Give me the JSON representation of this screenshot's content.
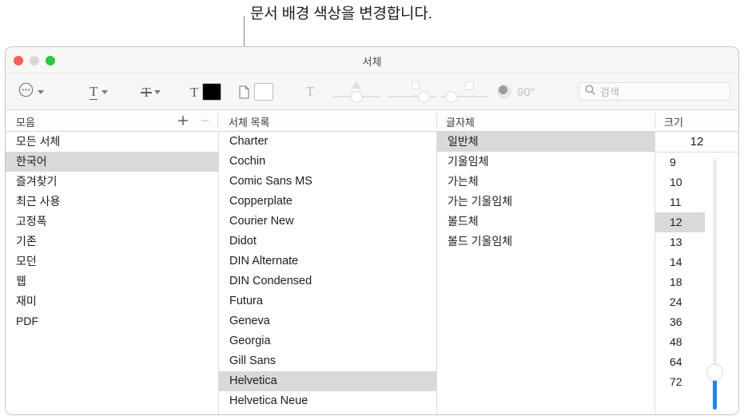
{
  "annotation": {
    "text": "문서 배경 색상을 변경합니다.",
    "line_color": "#8a8a8a"
  },
  "window": {
    "title": "서체",
    "traffic_lights": {
      "close": "#ff5f57",
      "minimize": "#d8d8d8",
      "zoom": "#28c840"
    }
  },
  "toolbar": {
    "action_menu": "action-menu",
    "underline_menu": "underline-menu",
    "strikethrough_menu": "strikethrough-menu",
    "text_color_label": "T",
    "text_color_value": "#000000",
    "document_color_value": "#ffffff",
    "shadow_toggle_label": "T",
    "shadow_opacity_slider": "shadow-opacity",
    "shadow_blur_slider": "shadow-blur",
    "shadow_offset_slider": "shadow-offset",
    "shadow_angle_value": "90°",
    "search": {
      "placeholder": "검색",
      "value": ""
    }
  },
  "columns": {
    "collection_header": "모음",
    "add_button": "+",
    "remove_button": "−",
    "family_header": "서체 목록",
    "typeface_header": "글자체",
    "size_header": "크기"
  },
  "collections": {
    "items": [
      {
        "label": "모든 서체",
        "selected": false
      },
      {
        "label": "한국어",
        "selected": true
      },
      {
        "label": "즐겨찾기",
        "selected": false
      },
      {
        "label": "최근 사용",
        "selected": false
      },
      {
        "label": "고정폭",
        "selected": false
      },
      {
        "label": "기존",
        "selected": false
      },
      {
        "label": "모던",
        "selected": false
      },
      {
        "label": "웹",
        "selected": false
      },
      {
        "label": "재미",
        "selected": false
      },
      {
        "label": "PDF",
        "selected": false
      }
    ]
  },
  "families": {
    "items": [
      {
        "label": "Charter",
        "selected": false
      },
      {
        "label": "Cochin",
        "selected": false
      },
      {
        "label": "Comic Sans MS",
        "selected": false
      },
      {
        "label": "Copperplate",
        "selected": false
      },
      {
        "label": "Courier New",
        "selected": false
      },
      {
        "label": "Didot",
        "selected": false
      },
      {
        "label": "DIN Alternate",
        "selected": false
      },
      {
        "label": "DIN Condensed",
        "selected": false
      },
      {
        "label": "Futura",
        "selected": false
      },
      {
        "label": "Geneva",
        "selected": false
      },
      {
        "label": "Georgia",
        "selected": false
      },
      {
        "label": "Gill Sans",
        "selected": false
      },
      {
        "label": "Helvetica",
        "selected": true
      },
      {
        "label": "Helvetica Neue",
        "selected": false
      }
    ]
  },
  "typefaces": {
    "items": [
      {
        "label": "일반체",
        "selected": true
      },
      {
        "label": "기울임체",
        "selected": false
      },
      {
        "label": "가는체",
        "selected": false
      },
      {
        "label": "가는 기울임체",
        "selected": false
      },
      {
        "label": "볼드체",
        "selected": false
      },
      {
        "label": "볼드 기울임체",
        "selected": false
      }
    ]
  },
  "sizes": {
    "current_value": "12",
    "items": [
      {
        "label": "9",
        "selected": false
      },
      {
        "label": "10",
        "selected": false
      },
      {
        "label": "11",
        "selected": false
      },
      {
        "label": "12",
        "selected": true
      },
      {
        "label": "13",
        "selected": false
      },
      {
        "label": "14",
        "selected": false
      },
      {
        "label": "18",
        "selected": false
      },
      {
        "label": "24",
        "selected": false
      },
      {
        "label": "36",
        "selected": false
      },
      {
        "label": "48",
        "selected": false
      },
      {
        "label": "64",
        "selected": false
      },
      {
        "label": "72",
        "selected": false
      }
    ],
    "slider_accent": "#1a84ff"
  }
}
